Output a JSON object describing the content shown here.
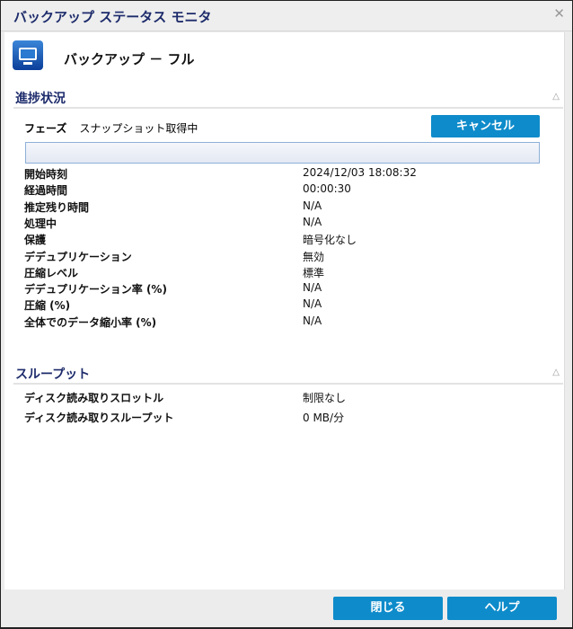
{
  "window": {
    "title": "バックアップ ステータス モニタ",
    "close_label": "✕"
  },
  "header": {
    "title": "バックアップ － フル",
    "icon": "backup-monitor-icon"
  },
  "progress_section": {
    "title": "進捗状況",
    "phase_label": "フェーズ",
    "phase_value": "スナップショット取得中",
    "cancel_label": "キャンセル",
    "progress_percent": 0,
    "rows": [
      {
        "k": "開始時刻",
        "v": "2024/12/03 18:08:32"
      },
      {
        "k": "経過時間",
        "v": "00:00:30"
      },
      {
        "k": "推定残り時間",
        "v": "N/A"
      },
      {
        "k": "処理中",
        "v": "N/A"
      },
      {
        "k": "保護",
        "v": "暗号化なし"
      },
      {
        "k": "デデュプリケーション",
        "v": "無効"
      },
      {
        "k": "圧縮レベル",
        "v": "標準"
      },
      {
        "k": "デデュプリケーション率 (%)",
        "v": "N/A"
      },
      {
        "k": "圧縮 (%)",
        "v": "N/A"
      },
      {
        "k": "全体でのデータ縮小率 (%)",
        "v": "N/A"
      }
    ]
  },
  "throughput_section": {
    "title": "スループット",
    "rows": [
      {
        "k": "ディスク読み取りスロットル",
        "v": "制限なし"
      },
      {
        "k": "ディスク読み取りスループット",
        "v": "0 MB/分"
      }
    ]
  },
  "footer": {
    "close_label": "閉じる",
    "help_label": "ヘルプ"
  }
}
